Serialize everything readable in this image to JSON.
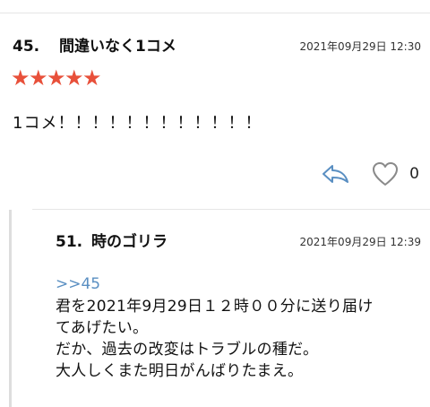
{
  "comment1": {
    "number": "45.",
    "name": "間違いなく1コメ",
    "date": "2021年09月29日 12:30",
    "stars": 5,
    "star_glyph": "★",
    "star_color": "#e8503a",
    "body": "1コメ！！！！！！！！！！！！",
    "like_count": "0",
    "icons": {
      "reply": "reply-arrow-icon",
      "like": "heart-icon"
    }
  },
  "comment2": {
    "number": "51.",
    "name": "時のゴリラ",
    "date": "2021年09月29日 12:39",
    "anchor": ">>45",
    "anchor_color": "#5a8fc2",
    "body_lines": [
      "君を2021年9月29日１２時００分に送り届け",
      "てあげたい。",
      "だか、過去の改変はトラブルの種だ。",
      "大人しくまた明日がんばりたまえ。"
    ]
  }
}
